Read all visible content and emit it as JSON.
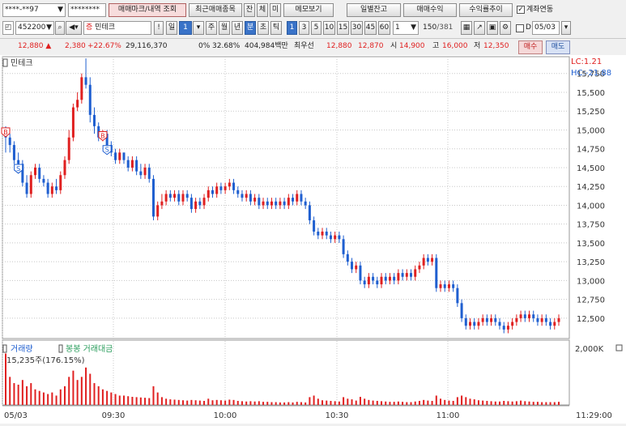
{
  "toolbar1": {
    "account_no": "****-**97",
    "password": "********",
    "menu_btn": "매매마크/내역 조회",
    "recent_btn": "최근매매종목",
    "tab_jan": "잔",
    "tab_che": "체",
    "tab_mi": "미",
    "memo_btn": "메모보기",
    "daily_btn": "일별잔고",
    "profit_btn": "매매수익",
    "rate_btn": "수익률추이",
    "link_label": "계좌연동"
  },
  "toolbar2": {
    "code": "452200",
    "stock_name": "민테크",
    "badge": "증",
    "excl": "!",
    "period_il": "일",
    "period_num": "1",
    "period_ju": "주",
    "period_wol": "월",
    "period_nyeon": "년",
    "period_bun": "분",
    "period_cho": "초",
    "period_tik": "틱",
    "intervals": [
      "1",
      "3",
      "5",
      "10",
      "15",
      "30",
      "45",
      "60"
    ],
    "selected_interval": "1",
    "count_select": "1",
    "count_value": "150",
    "count_total": "/381",
    "date_value": "05/03"
  },
  "quote": {
    "price": "12,880",
    "change": "2,380",
    "change_pct": "+22.67%",
    "volume": "29,116,370",
    "vol_rate": "0%",
    "turnover_pct": "32.68%",
    "amount": "404,984백만",
    "priority_label": "최우선",
    "ask": "12,880",
    "bid": "12,870",
    "open_label": "시",
    "open": "14,900",
    "high_label": "고",
    "high": "16,000",
    "low_label": "저",
    "low": "12,350",
    "buy_btn": "매수",
    "sell_btn": "매도"
  },
  "colors": {
    "up": "#e02020",
    "down": "#1f5fd0",
    "grid": "#c8c8c8",
    "volume": "#e02020"
  },
  "chart_data": {
    "type": "candlestick",
    "price_panel_title": "민테크",
    "lc_label": "LC:1.21",
    "hc_label": "HC:-21.88",
    "yticks": [
      "15,750",
      "15,500",
      "15,250",
      "15,000",
      "14,750",
      "14,500",
      "14,250",
      "14,000",
      "13,750",
      "13,500",
      "13,250",
      "13,000",
      "12,750",
      "12,500"
    ],
    "ytick_values": [
      15750,
      15500,
      15250,
      15000,
      14750,
      14500,
      14250,
      14000,
      13750,
      13500,
      13250,
      13000,
      12750,
      12500
    ],
    "ylim": [
      12230,
      15930
    ],
    "volume_title": "거래량",
    "volume_subtitle": "봉봉 거래대금",
    "volume_readout": "15,235주(176.15%)",
    "volume_ytick": "2,000K",
    "volume_ylim": [
      0,
      2000
    ],
    "xticks": [
      "05/03",
      "09:30",
      "10:00",
      "10:30",
      "11:00",
      "11:29:00"
    ],
    "markers": [
      {
        "label": "B",
        "bar": 0
      },
      {
        "label": "S",
        "bar": 3
      },
      {
        "label": "B",
        "bar": 23
      },
      {
        "label": "S",
        "bar": 24
      }
    ],
    "candles": [
      [
        15000,
        14900,
        14700,
        15050,
        1650
      ],
      [
        14900,
        14800,
        14700,
        14950,
        900
      ],
      [
        14800,
        14600,
        14550,
        14850,
        700
      ],
      [
        14600,
        14550,
        14500,
        14700,
        650
      ],
      [
        14550,
        14300,
        14250,
        14600,
        800
      ],
      [
        14300,
        14150,
        14100,
        14400,
        600
      ],
      [
        14150,
        14400,
        14100,
        14450,
        700
      ],
      [
        14400,
        14500,
        14350,
        14550,
        500
      ],
      [
        14500,
        14350,
        14300,
        14550,
        450
      ],
      [
        14350,
        14300,
        14250,
        14400,
        400
      ],
      [
        14300,
        14150,
        14100,
        14350,
        350
      ],
      [
        14150,
        14250,
        14100,
        14300,
        400
      ],
      [
        14250,
        14200,
        14150,
        14350,
        300
      ],
      [
        14200,
        14400,
        14150,
        14450,
        500
      ],
      [
        14400,
        14600,
        14350,
        14650,
        600
      ],
      [
        14600,
        14900,
        14550,
        15000,
        900
      ],
      [
        14900,
        15300,
        14850,
        15350,
        1100
      ],
      [
        15300,
        15400,
        15250,
        15500,
        800
      ],
      [
        15400,
        15700,
        15350,
        15750,
        900
      ],
      [
        15700,
        15600,
        15550,
        15950,
        1200
      ],
      [
        15600,
        15200,
        15100,
        15700,
        1000
      ],
      [
        15200,
        15050,
        14950,
        15300,
        700
      ],
      [
        15050,
        14900,
        14850,
        15100,
        600
      ],
      [
        14900,
        14950,
        14850,
        15000,
        500
      ],
      [
        14950,
        14800,
        14750,
        15000,
        450
      ],
      [
        14800,
        14700,
        14650,
        14850,
        400
      ],
      [
        14700,
        14600,
        14550,
        14750,
        350
      ],
      [
        14600,
        14700,
        14550,
        14750,
        300
      ],
      [
        14700,
        14600,
        14550,
        14700,
        300
      ],
      [
        14600,
        14500,
        14450,
        14650,
        280
      ],
      [
        14500,
        14600,
        14450,
        14650,
        260
      ],
      [
        14600,
        14450,
        14400,
        14650,
        250
      ],
      [
        14450,
        14400,
        14350,
        14550,
        240
      ],
      [
        14400,
        14500,
        14350,
        14550,
        230
      ],
      [
        14500,
        14350,
        14300,
        14550,
        220
      ],
      [
        14350,
        13850,
        13800,
        14400,
        600
      ],
      [
        13850,
        14000,
        13800,
        14050,
        400
      ],
      [
        14000,
        14050,
        13950,
        14150,
        250
      ],
      [
        14050,
        14150,
        14000,
        14200,
        200
      ],
      [
        14150,
        14100,
        14050,
        14200,
        180
      ],
      [
        14100,
        14150,
        14050,
        14200,
        170
      ],
      [
        14150,
        14050,
        14000,
        14200,
        160
      ],
      [
        14050,
        14150,
        14000,
        14200,
        150
      ],
      [
        14150,
        14100,
        14050,
        14200,
        140
      ],
      [
        14100,
        13950,
        13900,
        14150,
        160
      ],
      [
        13950,
        14050,
        13900,
        14100,
        150
      ],
      [
        14050,
        14000,
        13950,
        14100,
        140
      ],
      [
        14000,
        14100,
        13950,
        14150,
        130
      ],
      [
        14100,
        14200,
        14050,
        14250,
        200
      ],
      [
        14200,
        14150,
        14100,
        14250,
        150
      ],
      [
        14150,
        14250,
        14100,
        14300,
        160
      ],
      [
        14250,
        14200,
        14150,
        14300,
        150
      ],
      [
        14200,
        14250,
        14150,
        14300,
        140
      ],
      [
        14250,
        14300,
        14200,
        14350,
        170
      ],
      [
        14300,
        14200,
        14150,
        14350,
        160
      ],
      [
        14200,
        14150,
        14100,
        14250,
        130
      ],
      [
        14150,
        14100,
        14050,
        14200,
        120
      ],
      [
        14100,
        14150,
        14050,
        14200,
        110
      ],
      [
        14150,
        14050,
        14000,
        14200,
        120
      ],
      [
        14050,
        14100,
        14000,
        14150,
        110
      ],
      [
        14100,
        14000,
        13950,
        14150,
        120
      ],
      [
        14000,
        14050,
        13950,
        14100,
        100
      ],
      [
        14050,
        14000,
        13950,
        14100,
        100
      ],
      [
        14000,
        14050,
        13950,
        14100,
        90
      ],
      [
        14050,
        14000,
        13950,
        14100,
        90
      ],
      [
        14000,
        14050,
        13950,
        14100,
        80
      ],
      [
        14050,
        14000,
        13950,
        14100,
        80
      ],
      [
        14000,
        14100,
        13950,
        14150,
        90
      ],
      [
        14100,
        14050,
        14000,
        14150,
        80
      ],
      [
        14050,
        14150,
        14000,
        14200,
        100
      ],
      [
        14150,
        14050,
        14000,
        14200,
        90
      ],
      [
        14050,
        14000,
        13950,
        14100,
        80
      ],
      [
        14000,
        13800,
        13750,
        14050,
        250
      ],
      [
        13800,
        13650,
        13600,
        13850,
        300
      ],
      [
        13650,
        13600,
        13550,
        13700,
        200
      ],
      [
        13600,
        13650,
        13550,
        13700,
        150
      ],
      [
        13650,
        13600,
        13550,
        13700,
        140
      ],
      [
        13600,
        13550,
        13500,
        13650,
        130
      ],
      [
        13550,
        13600,
        13500,
        13650,
        120
      ],
      [
        13600,
        13550,
        13500,
        13650,
        110
      ],
      [
        13550,
        13350,
        13300,
        13600,
        250
      ],
      [
        13350,
        13250,
        13200,
        13400,
        200
      ],
      [
        13250,
        13150,
        13100,
        13300,
        180
      ],
      [
        13150,
        13200,
        13100,
        13250,
        140
      ],
      [
        13200,
        13000,
        12950,
        13250,
        260
      ],
      [
        13000,
        12950,
        12900,
        13050,
        200
      ],
      [
        12950,
        13050,
        12900,
        13100,
        160
      ],
      [
        13050,
        13000,
        12950,
        13100,
        140
      ],
      [
        13000,
        12950,
        12900,
        13050,
        130
      ],
      [
        12950,
        13050,
        12900,
        13100,
        120
      ],
      [
        13050,
        13000,
        12950,
        13100,
        110
      ],
      [
        13000,
        13050,
        12950,
        13100,
        100
      ],
      [
        13050,
        13000,
        12950,
        13100,
        100
      ],
      [
        13000,
        13100,
        12950,
        13150,
        110
      ],
      [
        13100,
        13050,
        13000,
        13150,
        100
      ],
      [
        13050,
        13100,
        13000,
        13150,
        90
      ],
      [
        13100,
        13050,
        13000,
        13150,
        90
      ],
      [
        13050,
        13150,
        13000,
        13200,
        110
      ],
      [
        13150,
        13200,
        13100,
        13250,
        130
      ],
      [
        13200,
        13300,
        13150,
        13350,
        160
      ],
      [
        13300,
        13250,
        13200,
        13350,
        140
      ],
      [
        13250,
        13300,
        13200,
        13350,
        130
      ],
      [
        13300,
        12900,
        12850,
        13350,
        300
      ],
      [
        12900,
        12950,
        12850,
        13000,
        200
      ],
      [
        12950,
        12900,
        12850,
        13000,
        160
      ],
      [
        12900,
        12950,
        12850,
        13000,
        140
      ],
      [
        12950,
        12900,
        12850,
        13000,
        130
      ],
      [
        12900,
        12700,
        12650,
        12950,
        250
      ],
      [
        12700,
        12500,
        12450,
        12750,
        300
      ],
      [
        12500,
        12400,
        12350,
        12550,
        250
      ],
      [
        12400,
        12450,
        12350,
        12500,
        200
      ],
      [
        12450,
        12400,
        12350,
        12500,
        180
      ],
      [
        12400,
        12450,
        12350,
        12500,
        150
      ],
      [
        12450,
        12500,
        12400,
        12550,
        140
      ],
      [
        12500,
        12450,
        12400,
        12550,
        130
      ],
      [
        12450,
        12500,
        12400,
        12550,
        120
      ],
      [
        12500,
        12450,
        12400,
        12550,
        110
      ],
      [
        12450,
        12400,
        12350,
        12500,
        110
      ],
      [
        12400,
        12350,
        12300,
        12450,
        130
      ],
      [
        12350,
        12400,
        12300,
        12450,
        120
      ],
      [
        12400,
        12450,
        12350,
        12500,
        110
      ],
      [
        12450,
        12500,
        12400,
        12550,
        120
      ],
      [
        12500,
        12550,
        12450,
        12600,
        140
      ],
      [
        12550,
        12500,
        12450,
        12600,
        120
      ],
      [
        12500,
        12550,
        12450,
        12600,
        110
      ],
      [
        12550,
        12500,
        12450,
        12600,
        100
      ],
      [
        12500,
        12450,
        12400,
        12550,
        100
      ],
      [
        12450,
        12500,
        12400,
        12550,
        90
      ],
      [
        12500,
        12450,
        12400,
        12550,
        90
      ],
      [
        12450,
        12400,
        12350,
        12500,
        90
      ],
      [
        12400,
        12450,
        12350,
        12500,
        90
      ],
      [
        12450,
        12500,
        12400,
        12550,
        100
      ]
    ]
  }
}
